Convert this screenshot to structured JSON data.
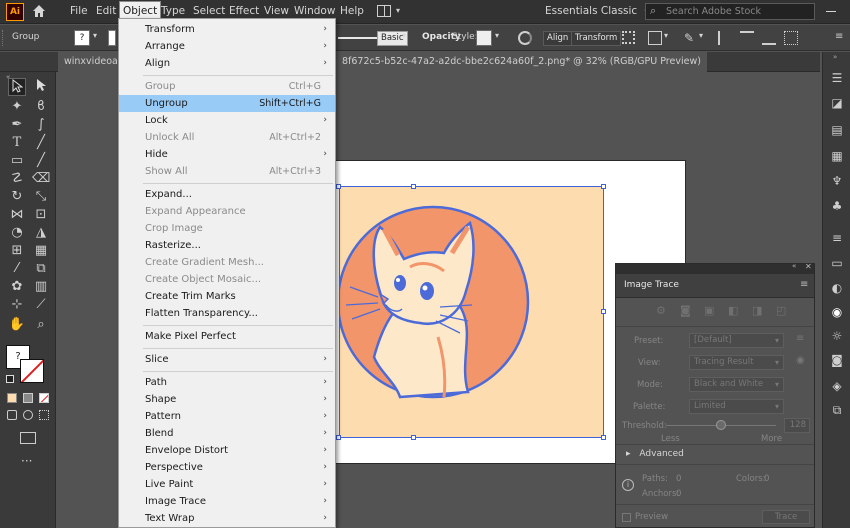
{
  "app": {
    "logo": "Ai",
    "accent": "#ff9a00"
  },
  "menubar": {
    "items": [
      "File",
      "Edit",
      "Object",
      "Type",
      "Select",
      "Effect",
      "View",
      "Window",
      "Help"
    ],
    "workspace": "Essentials Classic",
    "search_placeholder": "Search Adobe Stock"
  },
  "control_bar": {
    "selection_label": "Group",
    "stroke_profile": "Basic",
    "opacity_label": "Opacity",
    "style_label": "Style:",
    "align_label": "Align",
    "transform_label": "Transform"
  },
  "tabs": {
    "tab1": "winxvideoai_...",
    "tab2": "8f672c5-b52c-47a2-a2dc-bbe2c624a60f_2.png* @ 32% (RGB/GPU Preview)"
  },
  "object_menu": {
    "transform": "Transform",
    "arrange": "Arrange",
    "align": "Align",
    "group": "Group",
    "group_sc": "Ctrl+G",
    "ungroup": "Ungroup",
    "ungroup_sc": "Shift+Ctrl+G",
    "lock": "Lock",
    "unlock_all": "Unlock All",
    "unlock_all_sc": "Alt+Ctrl+2",
    "hide": "Hide",
    "show_all": "Show All",
    "show_all_sc": "Alt+Ctrl+3",
    "expand": "Expand...",
    "expand_appearance": "Expand Appearance",
    "crop_image": "Crop Image",
    "rasterize": "Rasterize...",
    "create_gradient_mesh": "Create Gradient Mesh...",
    "create_object_mosaic": "Create Object Mosaic...",
    "create_trim_marks": "Create Trim Marks",
    "flatten_transparency": "Flatten Transparency...",
    "make_pixel_perfect": "Make Pixel Perfect",
    "slice": "Slice",
    "path": "Path",
    "shape": "Shape",
    "pattern": "Pattern",
    "blend": "Blend",
    "envelope_distort": "Envelope Distort",
    "perspective": "Perspective",
    "live_paint": "Live Paint",
    "image_trace": "Image Trace",
    "text_wrap": "Text Wrap"
  },
  "image_trace_panel": {
    "title": "Image Trace",
    "preset_label": "Preset:",
    "preset_value": "[Default]",
    "view_label": "View:",
    "view_value": "Tracing Result",
    "mode_label": "Mode:",
    "mode_value": "Black and White",
    "palette_label": "Palette:",
    "palette_value": "Limited",
    "threshold_label": "Threshold:",
    "threshold_value": "128",
    "less": "Less",
    "more": "More",
    "threshold_level": 0.5,
    "advanced": "Advanced",
    "paths_label": "Paths:",
    "paths_value": "0",
    "colors_label": "Colors:",
    "colors_value": "0",
    "anchors_label": "Anchors:",
    "anchors_value": "0",
    "preview_label": "Preview",
    "trace_button": "Trace"
  },
  "colors": {
    "artwork_bg": "#fddcaf",
    "artwork_circle": "#f2956a",
    "selection": "#3f62d8",
    "menu_highlight": "#99cbf7"
  }
}
